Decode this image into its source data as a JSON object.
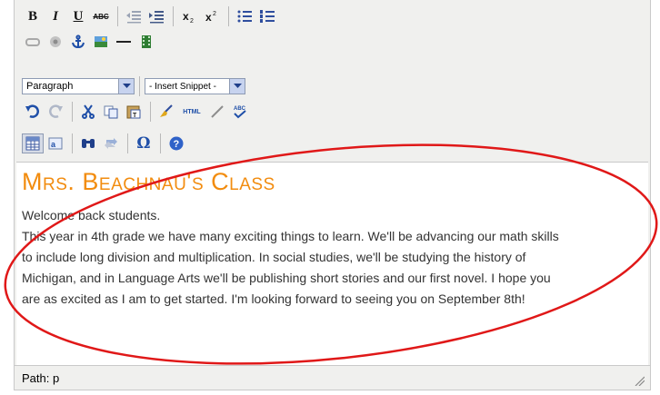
{
  "toolbar": {
    "row1": {
      "bold": "B",
      "italic": "I",
      "underline": "U",
      "strike": "ABC"
    },
    "format_select": {
      "value": "Paragraph"
    },
    "snippet_select": {
      "value": "- Insert Snippet -"
    },
    "html_label": "HTML",
    "spell_label": "ABC",
    "omega": "Ω"
  },
  "content": {
    "heading": "Mrs. Beachnau's Class",
    "lines": [
      "Welcome back students.",
      "This year in 4th grade we have many exciting things to learn.  We'll be advancing our math skills",
      "to include long division and multiplication.  In social studies, we'll be studying the history of",
      "Michigan, and in Language Arts we'll be publishing short stories and our first novel.  I hope you",
      "are as excited as I am to get started.  I'm looking forward to seeing you on September 8th!"
    ]
  },
  "statusbar": {
    "path": "Path: p"
  },
  "colors": {
    "heading": "#f28c0f",
    "annotation": "#e01818",
    "toolbar_bg": "#f0f0ee"
  }
}
